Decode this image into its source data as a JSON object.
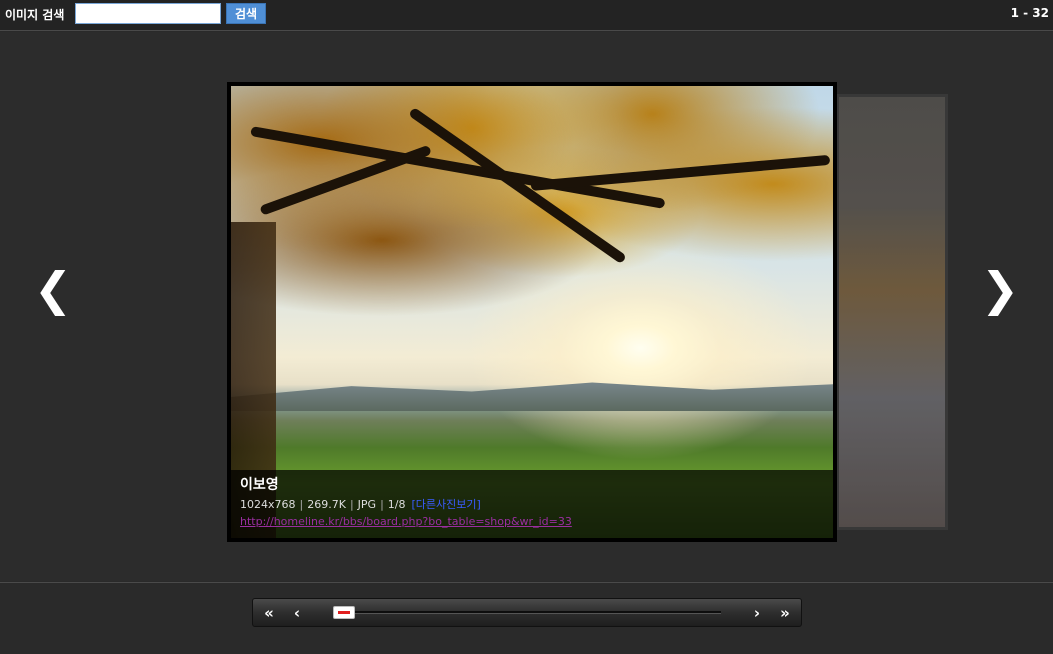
{
  "search": {
    "label": "이미지 검색",
    "input_value": "",
    "button_label": "검색"
  },
  "range_label": "1 - 32",
  "nav": {
    "prev_arrow": "❮",
    "next_arrow": "❯"
  },
  "photo": {
    "title": "이보영",
    "dimensions": "1024x768",
    "size": "269.7K",
    "format": "JPG",
    "index": "1/8",
    "more_link": "[다른사진보기]",
    "url": "http://homeline.kr/bbs/board.php?bo_table=shop&wr_id=33"
  },
  "pager": {
    "first": "«",
    "prev": "‹",
    "next": "›",
    "last": "»",
    "position": 0.0
  }
}
